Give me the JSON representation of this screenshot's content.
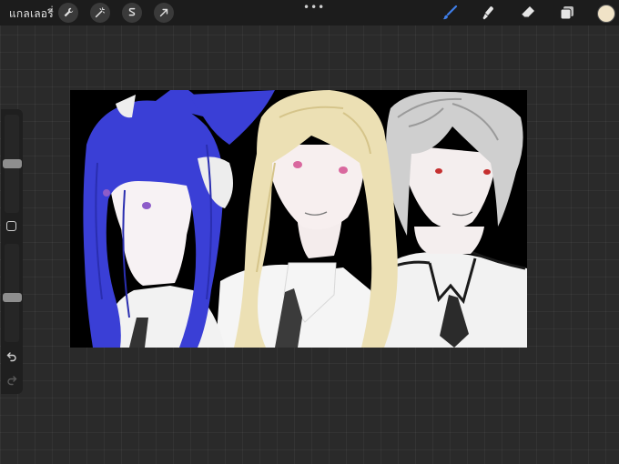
{
  "toolbar": {
    "gallery_label": "แกลเลอรี่",
    "more_label": "•••",
    "left_tools": [
      {
        "icon": "wrench-icon",
        "name": "actions"
      },
      {
        "icon": "magic-wand-icon",
        "name": "adjustments"
      },
      {
        "icon": "selection-icon",
        "name": "selection"
      },
      {
        "icon": "transform-arrow-icon",
        "name": "transform"
      }
    ],
    "right_tools": [
      {
        "icon": "brush-icon",
        "name": "paint",
        "active": true
      },
      {
        "icon": "smudge-icon",
        "name": "smudge"
      },
      {
        "icon": "eraser-icon",
        "name": "eraser"
      },
      {
        "icon": "layers-icon",
        "name": "layers"
      }
    ],
    "current_color": "#f0e3c7",
    "active_color": "#3f7ee8"
  },
  "sidebar": {
    "brush_size_level": 0.5,
    "opacity_level": 0.45,
    "undo_icon": "undo-arrow-icon",
    "redo_icon": "redo-arrow-icon",
    "modify_icon": "square-modify-icon"
  },
  "canvas": {
    "description_colors": {
      "background": "#000000",
      "blue_hair": "#3a3fd6",
      "blonde_hair": "#ece0b4",
      "silver_hair": "#cfcfcf",
      "skin": "#f7f1f1",
      "shirt": "#f2f2f2"
    }
  }
}
